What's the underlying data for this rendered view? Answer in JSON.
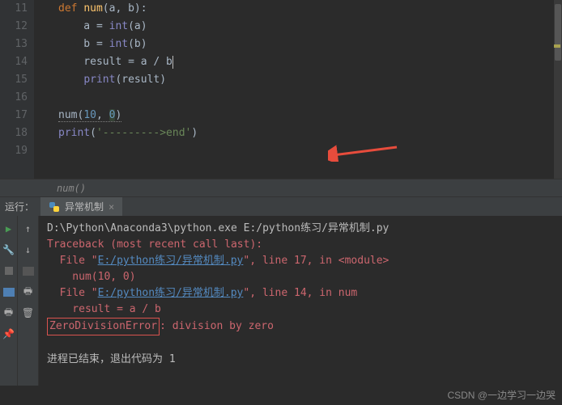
{
  "editor": {
    "lines": {
      "n11": "11",
      "n12": "12",
      "n13": "13",
      "n14": "14",
      "n15": "15",
      "n16": "16",
      "n17": "17",
      "n18": "18",
      "n19": "19"
    },
    "code": {
      "def": "def ",
      "fn_name": "num",
      "params": "(a, b):",
      "l12_a": "    a = ",
      "l12_int": "int",
      "l12_p": "(a)",
      "l13_a": "    b = ",
      "l13_int": "int",
      "l13_p": "(b)",
      "l14": "    result = a / b",
      "l15_a": "    ",
      "l15_print": "print",
      "l15_p": "(result)",
      "l17_fn": "num",
      "l17_p1": "(",
      "l17_n1": "10",
      "l17_c": ", ",
      "l17_n2": "0",
      "l17_p2": ")",
      "l18_print": "print",
      "l18_p1": "(",
      "l18_str": "'--------->end'",
      "l18_p2": ")"
    }
  },
  "breadcrumb": "num()",
  "run": {
    "label": "运行：",
    "tab": "异常机制"
  },
  "console": {
    "l1": "D:\\Python\\Anaconda3\\python.exe E:/python练习/异常机制.py",
    "l2": "Traceback (most recent call last):",
    "l3a": "  File \"",
    "l3link": "E:/python练习/异常机制.py",
    "l3b": "\", line 17, in <module>",
    "l4": "    num(10, 0)",
    "l5a": "  File \"",
    "l5link": "E:/python练习/异常机制.py",
    "l5b": "\", line 14, in num",
    "l6": "    result = a / b",
    "l7_err": "ZeroDivisionError",
    "l7_rest": ": division by zero",
    "l9": "进程已结束，退出代码为 1"
  },
  "watermark": "CSDN @一边学习一边哭"
}
